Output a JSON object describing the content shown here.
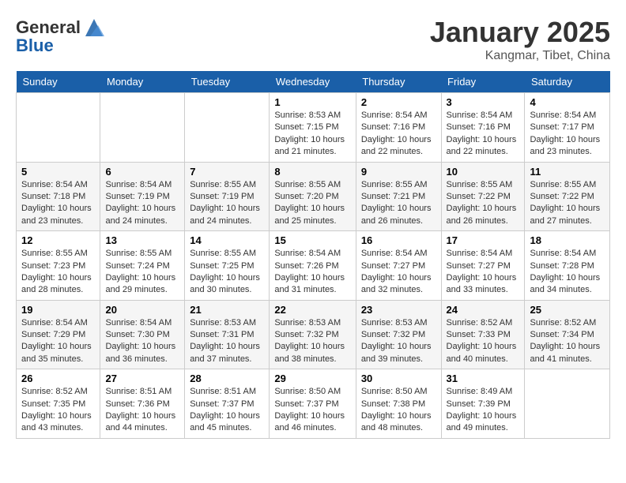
{
  "header": {
    "logo": {
      "general": "General",
      "blue": "Blue"
    },
    "month": "January 2025",
    "location": "Kangmar, Tibet, China"
  },
  "weekdays": [
    "Sunday",
    "Monday",
    "Tuesday",
    "Wednesday",
    "Thursday",
    "Friday",
    "Saturday"
  ],
  "weeks": [
    [
      {
        "day": "",
        "sunrise": "",
        "sunset": "",
        "daylight": ""
      },
      {
        "day": "",
        "sunrise": "",
        "sunset": "",
        "daylight": ""
      },
      {
        "day": "",
        "sunrise": "",
        "sunset": "",
        "daylight": ""
      },
      {
        "day": "1",
        "sunrise": "Sunrise: 8:53 AM",
        "sunset": "Sunset: 7:15 PM",
        "daylight": "Daylight: 10 hours and 21 minutes."
      },
      {
        "day": "2",
        "sunrise": "Sunrise: 8:54 AM",
        "sunset": "Sunset: 7:16 PM",
        "daylight": "Daylight: 10 hours and 22 minutes."
      },
      {
        "day": "3",
        "sunrise": "Sunrise: 8:54 AM",
        "sunset": "Sunset: 7:16 PM",
        "daylight": "Daylight: 10 hours and 22 minutes."
      },
      {
        "day": "4",
        "sunrise": "Sunrise: 8:54 AM",
        "sunset": "Sunset: 7:17 PM",
        "daylight": "Daylight: 10 hours and 23 minutes."
      }
    ],
    [
      {
        "day": "5",
        "sunrise": "Sunrise: 8:54 AM",
        "sunset": "Sunset: 7:18 PM",
        "daylight": "Daylight: 10 hours and 23 minutes."
      },
      {
        "day": "6",
        "sunrise": "Sunrise: 8:54 AM",
        "sunset": "Sunset: 7:19 PM",
        "daylight": "Daylight: 10 hours and 24 minutes."
      },
      {
        "day": "7",
        "sunrise": "Sunrise: 8:55 AM",
        "sunset": "Sunset: 7:19 PM",
        "daylight": "Daylight: 10 hours and 24 minutes."
      },
      {
        "day": "8",
        "sunrise": "Sunrise: 8:55 AM",
        "sunset": "Sunset: 7:20 PM",
        "daylight": "Daylight: 10 hours and 25 minutes."
      },
      {
        "day": "9",
        "sunrise": "Sunrise: 8:55 AM",
        "sunset": "Sunset: 7:21 PM",
        "daylight": "Daylight: 10 hours and 26 minutes."
      },
      {
        "day": "10",
        "sunrise": "Sunrise: 8:55 AM",
        "sunset": "Sunset: 7:22 PM",
        "daylight": "Daylight: 10 hours and 26 minutes."
      },
      {
        "day": "11",
        "sunrise": "Sunrise: 8:55 AM",
        "sunset": "Sunset: 7:22 PM",
        "daylight": "Daylight: 10 hours and 27 minutes."
      }
    ],
    [
      {
        "day": "12",
        "sunrise": "Sunrise: 8:55 AM",
        "sunset": "Sunset: 7:23 PM",
        "daylight": "Daylight: 10 hours and 28 minutes."
      },
      {
        "day": "13",
        "sunrise": "Sunrise: 8:55 AM",
        "sunset": "Sunset: 7:24 PM",
        "daylight": "Daylight: 10 hours and 29 minutes."
      },
      {
        "day": "14",
        "sunrise": "Sunrise: 8:55 AM",
        "sunset": "Sunset: 7:25 PM",
        "daylight": "Daylight: 10 hours and 30 minutes."
      },
      {
        "day": "15",
        "sunrise": "Sunrise: 8:54 AM",
        "sunset": "Sunset: 7:26 PM",
        "daylight": "Daylight: 10 hours and 31 minutes."
      },
      {
        "day": "16",
        "sunrise": "Sunrise: 8:54 AM",
        "sunset": "Sunset: 7:27 PM",
        "daylight": "Daylight: 10 hours and 32 minutes."
      },
      {
        "day": "17",
        "sunrise": "Sunrise: 8:54 AM",
        "sunset": "Sunset: 7:27 PM",
        "daylight": "Daylight: 10 hours and 33 minutes."
      },
      {
        "day": "18",
        "sunrise": "Sunrise: 8:54 AM",
        "sunset": "Sunset: 7:28 PM",
        "daylight": "Daylight: 10 hours and 34 minutes."
      }
    ],
    [
      {
        "day": "19",
        "sunrise": "Sunrise: 8:54 AM",
        "sunset": "Sunset: 7:29 PM",
        "daylight": "Daylight: 10 hours and 35 minutes."
      },
      {
        "day": "20",
        "sunrise": "Sunrise: 8:54 AM",
        "sunset": "Sunset: 7:30 PM",
        "daylight": "Daylight: 10 hours and 36 minutes."
      },
      {
        "day": "21",
        "sunrise": "Sunrise: 8:53 AM",
        "sunset": "Sunset: 7:31 PM",
        "daylight": "Daylight: 10 hours and 37 minutes."
      },
      {
        "day": "22",
        "sunrise": "Sunrise: 8:53 AM",
        "sunset": "Sunset: 7:32 PM",
        "daylight": "Daylight: 10 hours and 38 minutes."
      },
      {
        "day": "23",
        "sunrise": "Sunrise: 8:53 AM",
        "sunset": "Sunset: 7:32 PM",
        "daylight": "Daylight: 10 hours and 39 minutes."
      },
      {
        "day": "24",
        "sunrise": "Sunrise: 8:52 AM",
        "sunset": "Sunset: 7:33 PM",
        "daylight": "Daylight: 10 hours and 40 minutes."
      },
      {
        "day": "25",
        "sunrise": "Sunrise: 8:52 AM",
        "sunset": "Sunset: 7:34 PM",
        "daylight": "Daylight: 10 hours and 41 minutes."
      }
    ],
    [
      {
        "day": "26",
        "sunrise": "Sunrise: 8:52 AM",
        "sunset": "Sunset: 7:35 PM",
        "daylight": "Daylight: 10 hours and 43 minutes."
      },
      {
        "day": "27",
        "sunrise": "Sunrise: 8:51 AM",
        "sunset": "Sunset: 7:36 PM",
        "daylight": "Daylight: 10 hours and 44 minutes."
      },
      {
        "day": "28",
        "sunrise": "Sunrise: 8:51 AM",
        "sunset": "Sunset: 7:37 PM",
        "daylight": "Daylight: 10 hours and 45 minutes."
      },
      {
        "day": "29",
        "sunrise": "Sunrise: 8:50 AM",
        "sunset": "Sunset: 7:37 PM",
        "daylight": "Daylight: 10 hours and 46 minutes."
      },
      {
        "day": "30",
        "sunrise": "Sunrise: 8:50 AM",
        "sunset": "Sunset: 7:38 PM",
        "daylight": "Daylight: 10 hours and 48 minutes."
      },
      {
        "day": "31",
        "sunrise": "Sunrise: 8:49 AM",
        "sunset": "Sunset: 7:39 PM",
        "daylight": "Daylight: 10 hours and 49 minutes."
      },
      {
        "day": "",
        "sunrise": "",
        "sunset": "",
        "daylight": ""
      }
    ]
  ]
}
